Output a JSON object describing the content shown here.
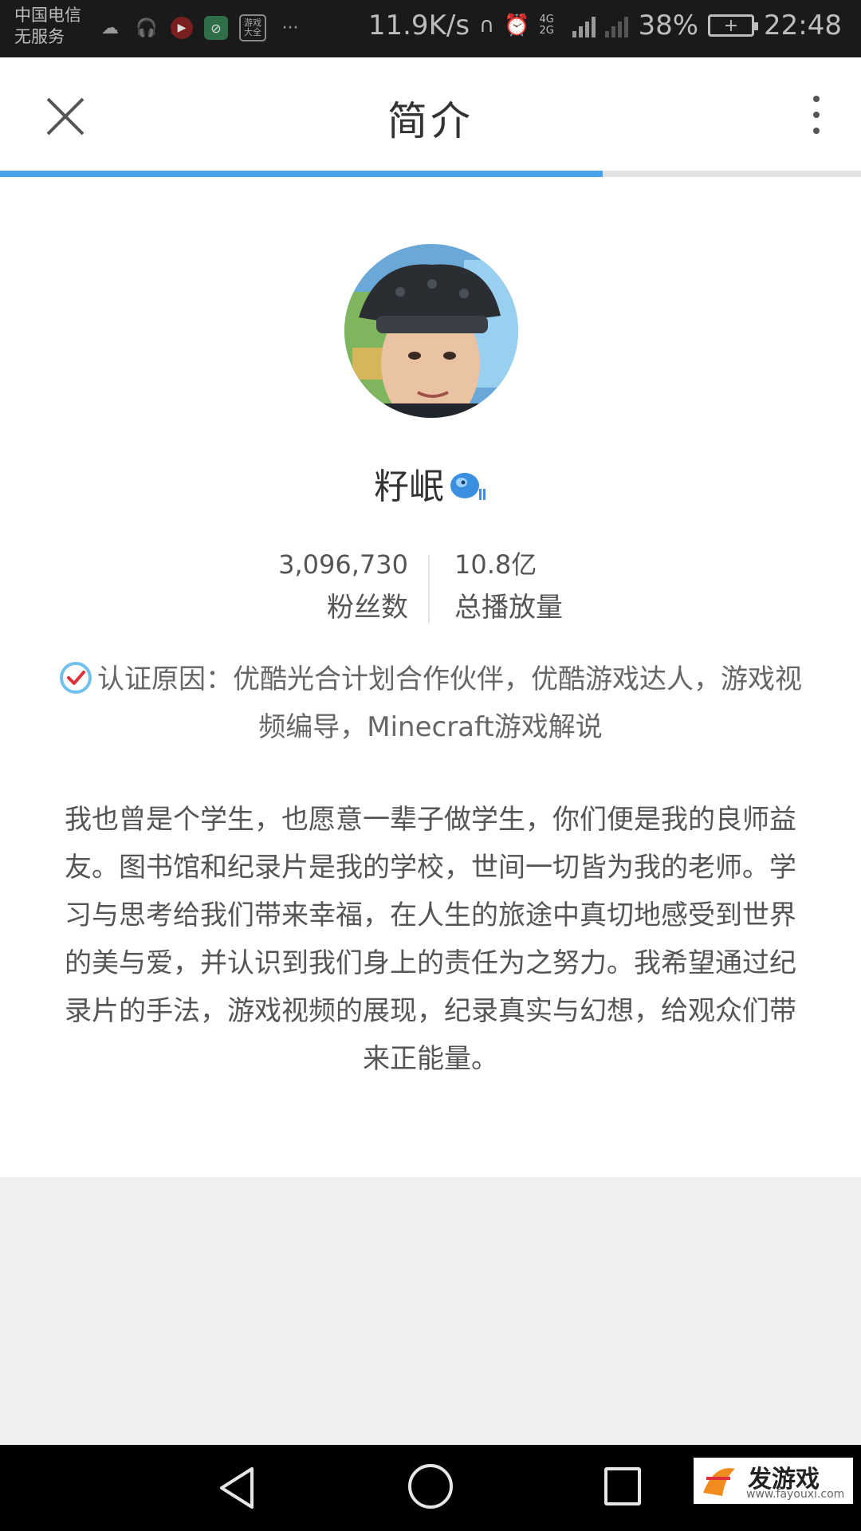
{
  "status_bar": {
    "carrier_line1": "中国电信",
    "carrier_line2": "无服务",
    "app_icon_game_label": "游戏大全",
    "more": "···",
    "net_speed": "11.9K/s",
    "network_type": "4G 2G",
    "battery": "38%",
    "time": "22:48"
  },
  "header": {
    "title": "简介",
    "progress_percent": 70
  },
  "profile": {
    "name": "籽岷",
    "followers_value": "3,096,730",
    "followers_label": "粉丝数",
    "plays_value": "10.8亿",
    "plays_label": "总播放量",
    "verification": "认证原因：优酷光合计划合作伙伴，优酷游戏达人，游戏视频编导，Minecraft游戏解说",
    "bio": "我也曾是个学生，也愿意一辈子做学生，你们便是我的良师益友。图书馆和纪录片是我的学校，世间一切皆为我的老师。学习与思考给我们带来幸福，在人生的旅途中真切地感受到世界的美与爱，并认识到我们身上的责任为之努力。我希望通过纪录片的手法，游戏视频的展现，纪录真实与幻想，给观众们带来正能量。"
  },
  "watermark": {
    "main": "发游戏",
    "sub": "www.fayouxi.com"
  },
  "colors": {
    "accent": "#4aa3e8",
    "verify_red": "#e0303a"
  }
}
